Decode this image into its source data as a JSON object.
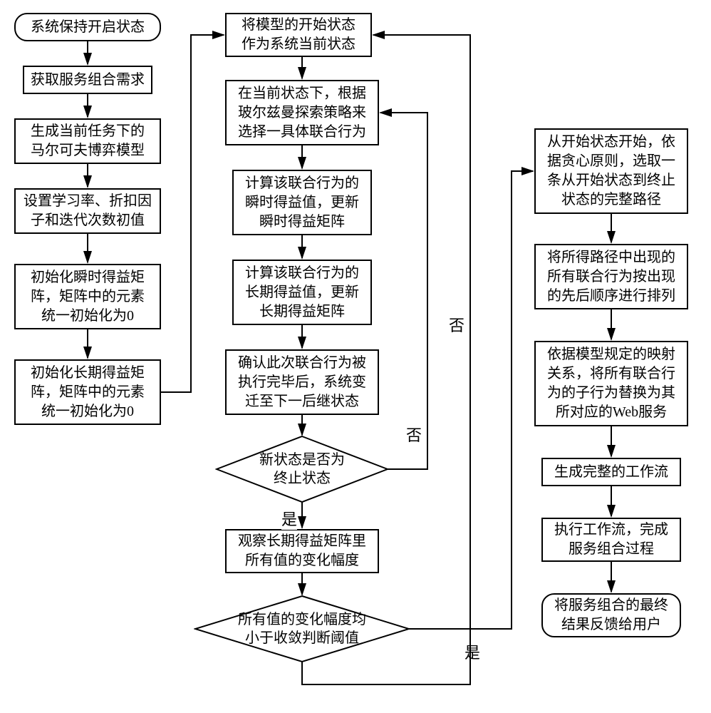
{
  "col1": {
    "n1": "系统保持开启状态",
    "n2": "获取服务组合需求",
    "n3": "生成当前任务下的\n马尔可夫博弈模型",
    "n4": "设置学习率、折扣因\n子和迭代次数初值",
    "n5": "初始化瞬时得益矩\n阵，矩阵中的元素\n统一初始化为0",
    "n6": "初始化长期得益矩\n阵，矩阵中的元素\n统一初始化为0"
  },
  "col2": {
    "n1": "将模型的开始状态\n作为系统当前状态",
    "n2": "在当前状态下，根据\n玻尔兹曼探索策略来\n选择一具体联合行为",
    "n3": "计算该联合行为的\n瞬时得益值，更新\n瞬时得益矩阵",
    "n4": "计算该联合行为的\n长期得益值，更新\n长期得益矩阵",
    "n5": "确认此次联合行为被\n执行完毕后，系统变\n迁至下一后继状态",
    "d1": "新状态是否为\n终止状态",
    "n6": "观察长期得益矩阵里\n所有值的变化幅度",
    "d2": "所有值的变化幅度均\n小于收敛判断阈值"
  },
  "col3": {
    "n1": "从开始状态开始，依\n据贪心原则，选取一\n条从开始状态到终止\n状态的完整路径",
    "n2": "将所得路径中出现的\n所有联合行为按出现\n的先后顺序进行排列",
    "n3": "依据模型规定的映射\n关系，将所有联合行\n为的子行为替换为其\n所对应的Web服务",
    "n4": "生成完整的工作流",
    "n5": "执行工作流，完成\n服务组合过程",
    "n6": "将服务组合的最终\n结果反馈给用户"
  },
  "labels": {
    "yes1": "是",
    "no1": "否",
    "yes2": "是",
    "no2": "否"
  }
}
